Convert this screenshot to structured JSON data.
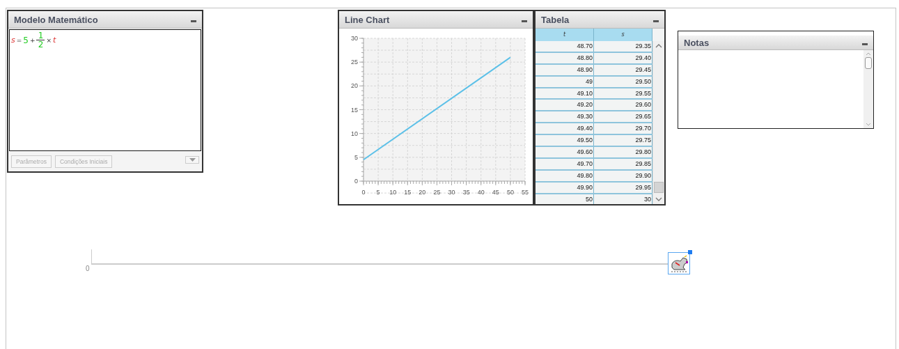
{
  "model_panel": {
    "title": "Modelo Matemático",
    "equation": [
      {
        "kind": "var",
        "text": "s"
      },
      {
        "kind": "op",
        "text": "="
      },
      {
        "kind": "num",
        "text": "5"
      },
      {
        "kind": "op",
        "text": "+"
      },
      {
        "kind": "frac",
        "numerator": "1",
        "denominator": "2"
      },
      {
        "kind": "op",
        "text": "×"
      },
      {
        "kind": "var",
        "text": "t"
      }
    ],
    "buttons": [
      {
        "label": "Parâmetros",
        "disabled": true
      },
      {
        "label": "Condições Iniciais",
        "disabled": true
      }
    ]
  },
  "chart_panel": {
    "title": "Line Chart",
    "chart_data": {
      "type": "line",
      "x": [
        0,
        50
      ],
      "series": [
        {
          "color": "#5bc0e8",
          "values": [
            4.5,
            26
          ]
        }
      ],
      "grid": true,
      "xlim": [
        0,
        55
      ],
      "ylim": [
        0,
        30
      ],
      "xticks": [
        0,
        5,
        10,
        15,
        20,
        25,
        30,
        35,
        40,
        45,
        50,
        55
      ],
      "yticks": [
        0,
        5,
        10,
        15,
        20,
        25,
        30
      ]
    }
  },
  "table_panel": {
    "title": "Tabela",
    "columns": [
      "t",
      "s"
    ],
    "rows": [
      [
        "48.70",
        "29.35"
      ],
      [
        "48.80",
        "29.40"
      ],
      [
        "48.90",
        "29.45"
      ],
      [
        "49",
        "29.50"
      ],
      [
        "49.10",
        "29.55"
      ],
      [
        "49.20",
        "29.60"
      ],
      [
        "49.30",
        "29.65"
      ],
      [
        "49.40",
        "29.70"
      ],
      [
        "49.50",
        "29.75"
      ],
      [
        "49.60",
        "29.80"
      ],
      [
        "49.70",
        "29.85"
      ],
      [
        "49.80",
        "29.90"
      ],
      [
        "49.90",
        "29.95"
      ],
      [
        "50",
        "30"
      ]
    ]
  },
  "notes_panel": {
    "title": "Notas"
  },
  "timeline": {
    "label": "0",
    "sprite_selected": true
  }
}
